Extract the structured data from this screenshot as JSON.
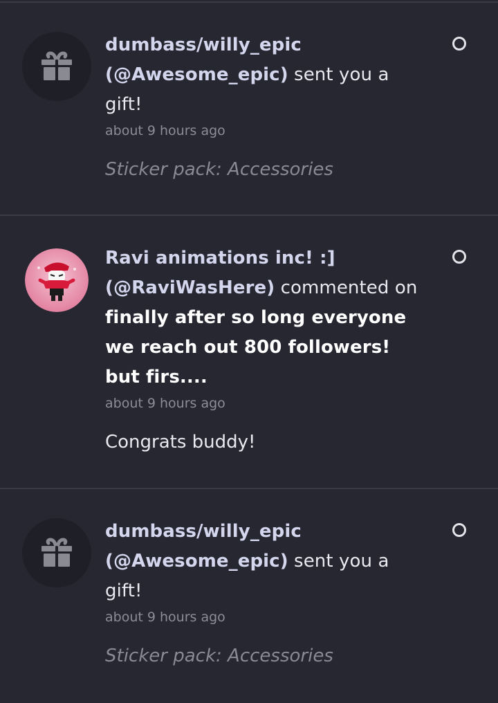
{
  "notifications": [
    {
      "type": "gift",
      "sender_name": "dumbass/willy_epic",
      "sender_handle": "(@Awesome_epic)",
      "action": " sent you a gift!",
      "timestamp": "about 9 hours ago",
      "detail": "Sticker pack: Accessories"
    },
    {
      "type": "comment",
      "sender_name": "Ravi animations inc! :]",
      "sender_handle": "(@RaviWasHere)",
      "action": " commented on ",
      "post_title": "finally after so long everyone we reach out 800 followers! but firs....",
      "timestamp": "about 9 hours ago",
      "detail": "Congrats buddy!"
    },
    {
      "type": "gift",
      "sender_name": "dumbass/willy_epic",
      "sender_handle": "(@Awesome_epic)",
      "action": " sent you a gift!",
      "timestamp": "about 9 hours ago",
      "detail": "Sticker pack: Accessories"
    }
  ],
  "colors": {
    "background": "#272731",
    "divider": "#3a3a45",
    "name_text": "#d4d6ee",
    "muted_text": "#8d8d98",
    "avatar_pink": "#e88aa8"
  },
  "icons": {
    "gift": "gift-icon",
    "unread": "unread-indicator-icon"
  }
}
